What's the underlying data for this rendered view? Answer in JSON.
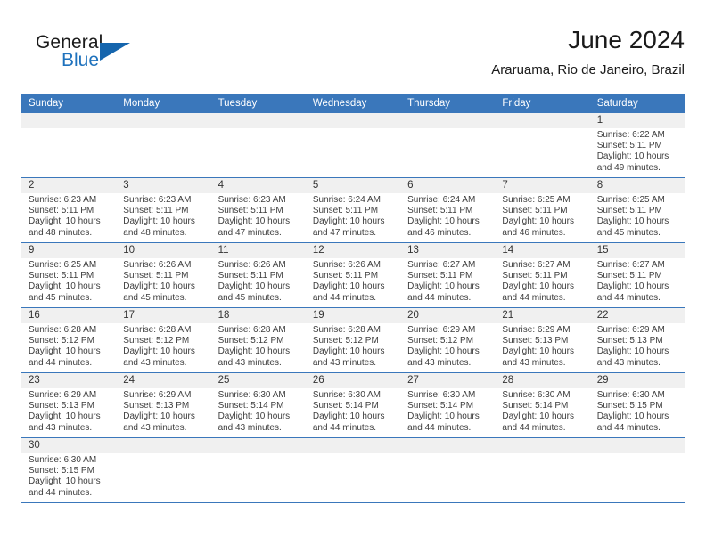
{
  "brand": {
    "line1": "General",
    "line2": "Blue",
    "accent_color": "#1565ad",
    "text_color": "#1a1a1a",
    "logo_icon": "triangle-flag-icon"
  },
  "header": {
    "title": "June 2024",
    "subtitle": "Araruama, Rio de Janeiro, Brazil"
  },
  "calendar": {
    "header_bg": "#3a77bb",
    "header_text": "#ffffff",
    "daynum_bg": "#f0f0f0",
    "weekdays": [
      "Sunday",
      "Monday",
      "Tuesday",
      "Wednesday",
      "Thursday",
      "Friday",
      "Saturday"
    ],
    "weeks": [
      [
        {
          "day": "",
          "empty": true
        },
        {
          "day": "",
          "empty": true
        },
        {
          "day": "",
          "empty": true
        },
        {
          "day": "",
          "empty": true
        },
        {
          "day": "",
          "empty": true
        },
        {
          "day": "",
          "empty": true
        },
        {
          "day": "1",
          "sunrise": "Sunrise: 6:22 AM",
          "sunset": "Sunset: 5:11 PM",
          "daylight": "Daylight: 10 hours and 49 minutes."
        }
      ],
      [
        {
          "day": "2",
          "sunrise": "Sunrise: 6:23 AM",
          "sunset": "Sunset: 5:11 PM",
          "daylight": "Daylight: 10 hours and 48 minutes."
        },
        {
          "day": "3",
          "sunrise": "Sunrise: 6:23 AM",
          "sunset": "Sunset: 5:11 PM",
          "daylight": "Daylight: 10 hours and 48 minutes."
        },
        {
          "day": "4",
          "sunrise": "Sunrise: 6:23 AM",
          "sunset": "Sunset: 5:11 PM",
          "daylight": "Daylight: 10 hours and 47 minutes."
        },
        {
          "day": "5",
          "sunrise": "Sunrise: 6:24 AM",
          "sunset": "Sunset: 5:11 PM",
          "daylight": "Daylight: 10 hours and 47 minutes."
        },
        {
          "day": "6",
          "sunrise": "Sunrise: 6:24 AM",
          "sunset": "Sunset: 5:11 PM",
          "daylight": "Daylight: 10 hours and 46 minutes."
        },
        {
          "day": "7",
          "sunrise": "Sunrise: 6:25 AM",
          "sunset": "Sunset: 5:11 PM",
          "daylight": "Daylight: 10 hours and 46 minutes."
        },
        {
          "day": "8",
          "sunrise": "Sunrise: 6:25 AM",
          "sunset": "Sunset: 5:11 PM",
          "daylight": "Daylight: 10 hours and 45 minutes."
        }
      ],
      [
        {
          "day": "9",
          "sunrise": "Sunrise: 6:25 AM",
          "sunset": "Sunset: 5:11 PM",
          "daylight": "Daylight: 10 hours and 45 minutes."
        },
        {
          "day": "10",
          "sunrise": "Sunrise: 6:26 AM",
          "sunset": "Sunset: 5:11 PM",
          "daylight": "Daylight: 10 hours and 45 minutes."
        },
        {
          "day": "11",
          "sunrise": "Sunrise: 6:26 AM",
          "sunset": "Sunset: 5:11 PM",
          "daylight": "Daylight: 10 hours and 45 minutes."
        },
        {
          "day": "12",
          "sunrise": "Sunrise: 6:26 AM",
          "sunset": "Sunset: 5:11 PM",
          "daylight": "Daylight: 10 hours and 44 minutes."
        },
        {
          "day": "13",
          "sunrise": "Sunrise: 6:27 AM",
          "sunset": "Sunset: 5:11 PM",
          "daylight": "Daylight: 10 hours and 44 minutes."
        },
        {
          "day": "14",
          "sunrise": "Sunrise: 6:27 AM",
          "sunset": "Sunset: 5:11 PM",
          "daylight": "Daylight: 10 hours and 44 minutes."
        },
        {
          "day": "15",
          "sunrise": "Sunrise: 6:27 AM",
          "sunset": "Sunset: 5:11 PM",
          "daylight": "Daylight: 10 hours and 44 minutes."
        }
      ],
      [
        {
          "day": "16",
          "sunrise": "Sunrise: 6:28 AM",
          "sunset": "Sunset: 5:12 PM",
          "daylight": "Daylight: 10 hours and 44 minutes."
        },
        {
          "day": "17",
          "sunrise": "Sunrise: 6:28 AM",
          "sunset": "Sunset: 5:12 PM",
          "daylight": "Daylight: 10 hours and 43 minutes."
        },
        {
          "day": "18",
          "sunrise": "Sunrise: 6:28 AM",
          "sunset": "Sunset: 5:12 PM",
          "daylight": "Daylight: 10 hours and 43 minutes."
        },
        {
          "day": "19",
          "sunrise": "Sunrise: 6:28 AM",
          "sunset": "Sunset: 5:12 PM",
          "daylight": "Daylight: 10 hours and 43 minutes."
        },
        {
          "day": "20",
          "sunrise": "Sunrise: 6:29 AM",
          "sunset": "Sunset: 5:12 PM",
          "daylight": "Daylight: 10 hours and 43 minutes."
        },
        {
          "day": "21",
          "sunrise": "Sunrise: 6:29 AM",
          "sunset": "Sunset: 5:13 PM",
          "daylight": "Daylight: 10 hours and 43 minutes."
        },
        {
          "day": "22",
          "sunrise": "Sunrise: 6:29 AM",
          "sunset": "Sunset: 5:13 PM",
          "daylight": "Daylight: 10 hours and 43 minutes."
        }
      ],
      [
        {
          "day": "23",
          "sunrise": "Sunrise: 6:29 AM",
          "sunset": "Sunset: 5:13 PM",
          "daylight": "Daylight: 10 hours and 43 minutes."
        },
        {
          "day": "24",
          "sunrise": "Sunrise: 6:29 AM",
          "sunset": "Sunset: 5:13 PM",
          "daylight": "Daylight: 10 hours and 43 minutes."
        },
        {
          "day": "25",
          "sunrise": "Sunrise: 6:30 AM",
          "sunset": "Sunset: 5:14 PM",
          "daylight": "Daylight: 10 hours and 43 minutes."
        },
        {
          "day": "26",
          "sunrise": "Sunrise: 6:30 AM",
          "sunset": "Sunset: 5:14 PM",
          "daylight": "Daylight: 10 hours and 44 minutes."
        },
        {
          "day": "27",
          "sunrise": "Sunrise: 6:30 AM",
          "sunset": "Sunset: 5:14 PM",
          "daylight": "Daylight: 10 hours and 44 minutes."
        },
        {
          "day": "28",
          "sunrise": "Sunrise: 6:30 AM",
          "sunset": "Sunset: 5:14 PM",
          "daylight": "Daylight: 10 hours and 44 minutes."
        },
        {
          "day": "29",
          "sunrise": "Sunrise: 6:30 AM",
          "sunset": "Sunset: 5:15 PM",
          "daylight": "Daylight: 10 hours and 44 minutes."
        }
      ],
      [
        {
          "day": "30",
          "sunrise": "Sunrise: 6:30 AM",
          "sunset": "Sunset: 5:15 PM",
          "daylight": "Daylight: 10 hours and 44 minutes."
        },
        {
          "day": "",
          "empty": true
        },
        {
          "day": "",
          "empty": true
        },
        {
          "day": "",
          "empty": true
        },
        {
          "day": "",
          "empty": true
        },
        {
          "day": "",
          "empty": true
        },
        {
          "day": "",
          "empty": true
        }
      ]
    ]
  }
}
